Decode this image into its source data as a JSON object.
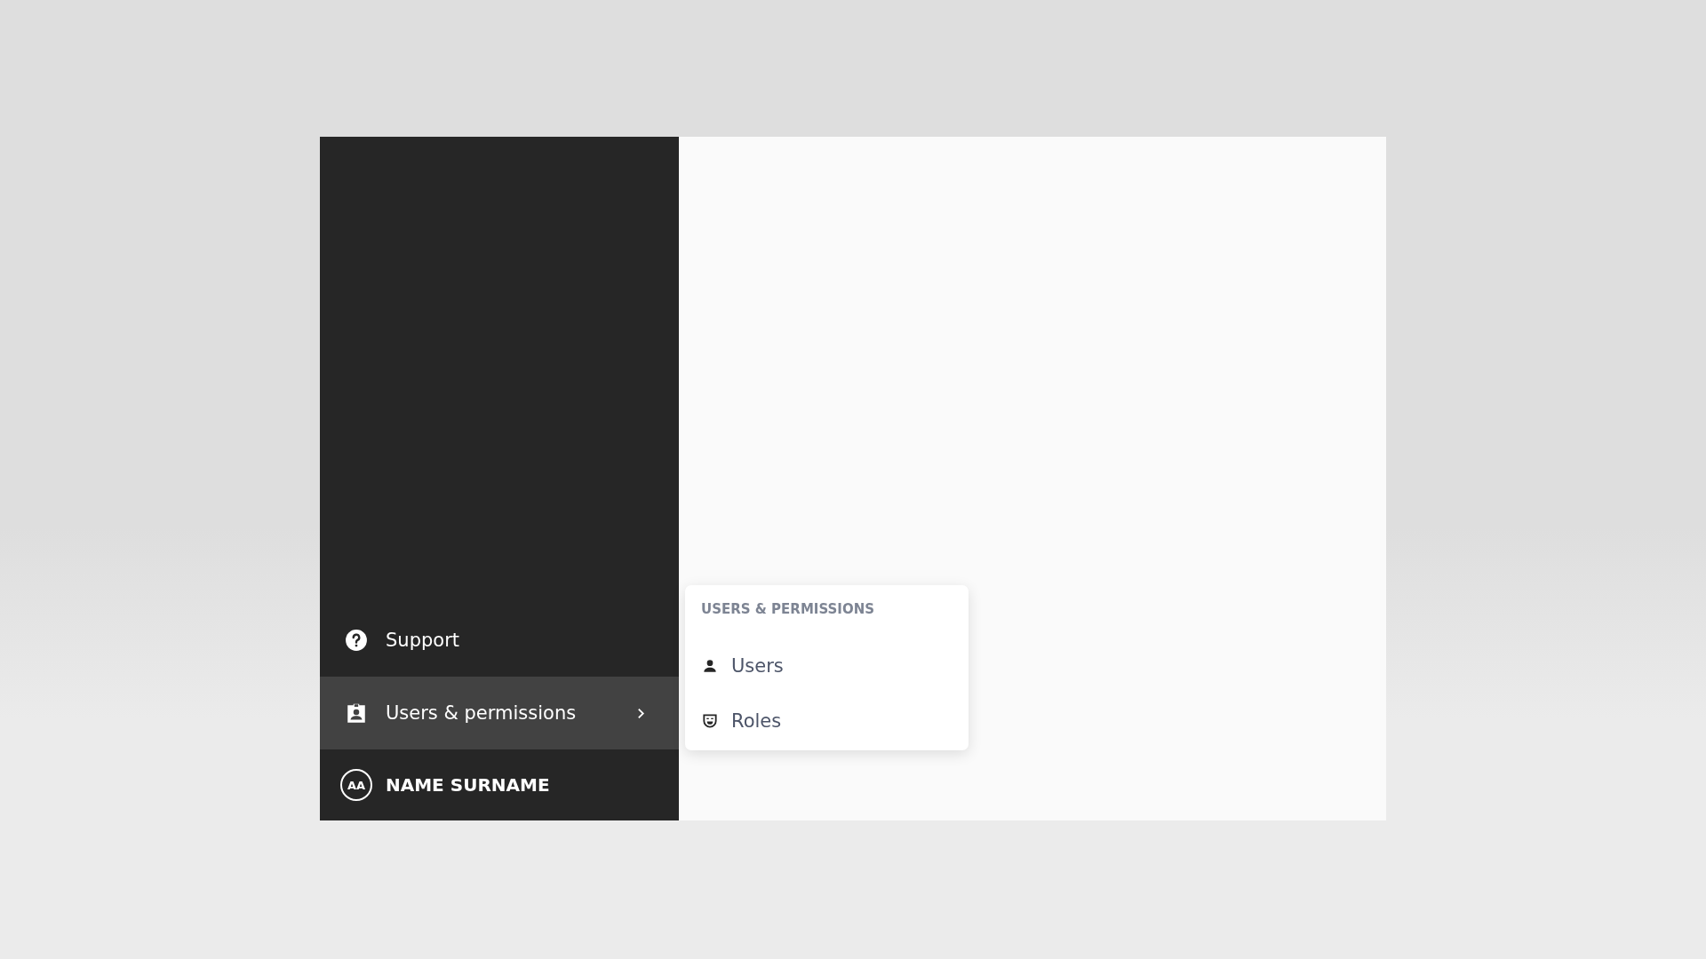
{
  "sidebar": {
    "items": [
      {
        "label": "Support",
        "selected": false,
        "has_submenu": false
      },
      {
        "label": "Users & permissions",
        "selected": true,
        "has_submenu": true
      }
    ],
    "user": {
      "initials": "AA",
      "name": "NAME SURNAME"
    }
  },
  "submenu": {
    "title": "USERS & PERMISSIONS",
    "items": [
      {
        "label": "Users"
      },
      {
        "label": "Roles"
      }
    ]
  }
}
